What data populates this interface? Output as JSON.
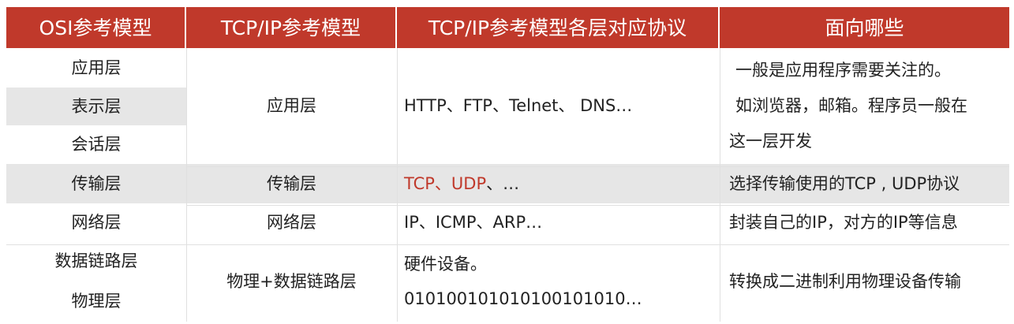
{
  "table": {
    "headers": [
      "OSI参考模型",
      "TCP/IP参考模型",
      "TCP/IP参考模型各层对应协议",
      "面向哪些"
    ],
    "osi_layers": [
      "应用层",
      "表示层",
      "会话层",
      "传输层",
      "网络层",
      "数据链路层",
      "物理层"
    ],
    "tcpip_layers": {
      "application": "应用层",
      "transport": "传输层",
      "network": "网络层",
      "physical": "物理+数据链路层"
    },
    "protocols": {
      "application": "HTTP、FTP、Telnet、 DNS…",
      "transport_tcp_udp": "TCP、UDP",
      "transport_rest": "、…",
      "network": "IP、ICMP、ARP…",
      "physical_line1": "硬件设备。",
      "physical_line2": "010100101010100101010…"
    },
    "audience": {
      "application_line1": "一般是应用程序需要关注的。",
      "application_line2": "如浏览器，邮箱。程序员一般在",
      "application_line3": "这一层开发",
      "transport": "选择传输使用的TCP , UDP协议",
      "network": "封装自己的IP，对方的IP等信息",
      "physical": "转换成二进制利用物理设备传输"
    }
  },
  "colors": {
    "header_bg": "#c0392b",
    "header_text": "#ffffff",
    "highlight": "#c0392b",
    "row_grey": "#e6e6e6"
  }
}
